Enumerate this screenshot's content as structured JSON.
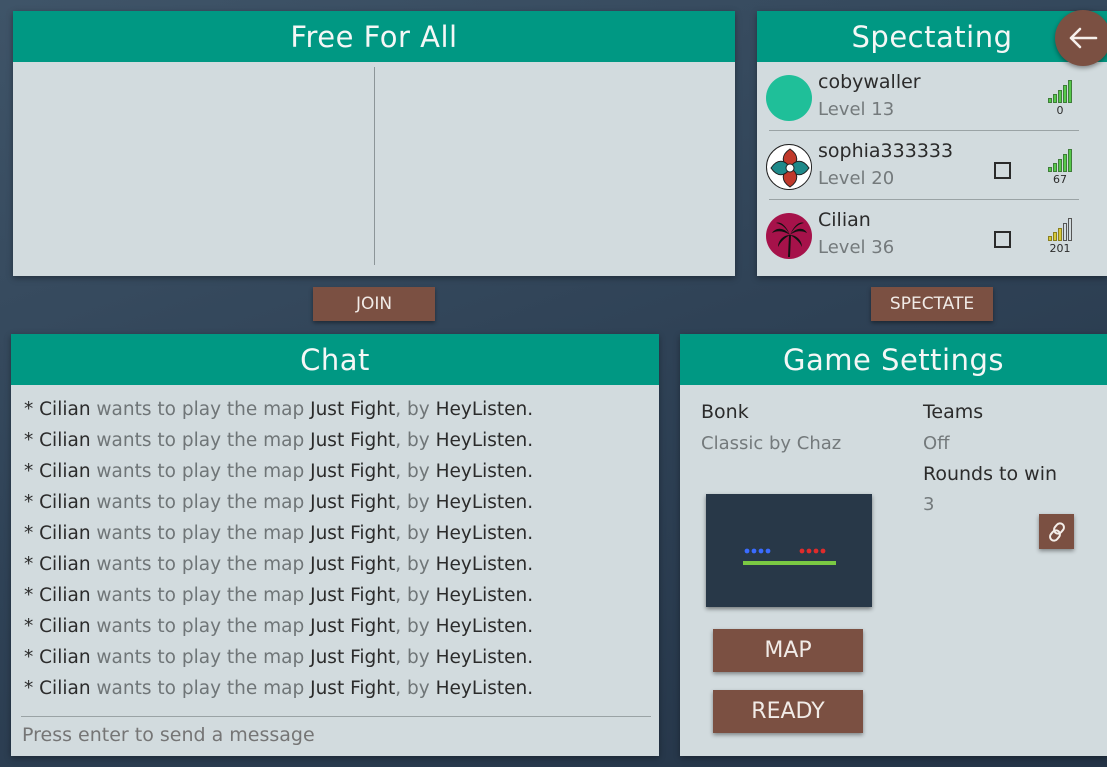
{
  "lobby": {
    "title": "Free For All",
    "join_label": "JOIN"
  },
  "spectating": {
    "title": "Spectating",
    "spectate_label": "SPECTATE",
    "players": [
      {
        "name": "cobywaller",
        "level": "Level 13",
        "ping": "0",
        "avatar_color": "#1fbf99",
        "show_checkbox": false,
        "signal_bars": 5,
        "signal_color": "#56c94a"
      },
      {
        "name": "sophia333333",
        "level": "Level 20",
        "ping": "67",
        "avatar_color": "#ffffff",
        "show_checkbox": true,
        "signal_bars": 5,
        "signal_color": "#56c94a"
      },
      {
        "name": "Cilian",
        "level": "Level 36",
        "ping": "201",
        "avatar_color": "#a6124a",
        "show_checkbox": true,
        "signal_bars": 3,
        "signal_color": "#d6c83a"
      }
    ]
  },
  "back_icon": "arrow-left-icon",
  "chat": {
    "title": "Chat",
    "messages": [
      {
        "prefix": "* ",
        "user": "Cilian",
        "text1": " wants to play the map ",
        "map": "Just Fight",
        "text2": ", by ",
        "author": "HeyListen",
        "end": "."
      },
      {
        "prefix": "* ",
        "user": "Cilian",
        "text1": " wants to play the map ",
        "map": "Just Fight",
        "text2": ", by ",
        "author": "HeyListen",
        "end": "."
      },
      {
        "prefix": "* ",
        "user": "Cilian",
        "text1": " wants to play the map ",
        "map": "Just Fight",
        "text2": ", by ",
        "author": "HeyListen",
        "end": "."
      },
      {
        "prefix": "* ",
        "user": "Cilian",
        "text1": " wants to play the map ",
        "map": "Just Fight",
        "text2": ", by ",
        "author": "HeyListen",
        "end": "."
      },
      {
        "prefix": "* ",
        "user": "Cilian",
        "text1": " wants to play the map ",
        "map": "Just Fight",
        "text2": ", by ",
        "author": "HeyListen",
        "end": "."
      },
      {
        "prefix": "* ",
        "user": "Cilian",
        "text1": " wants to play the map ",
        "map": "Just Fight",
        "text2": ", by ",
        "author": "HeyListen",
        "end": "."
      },
      {
        "prefix": "* ",
        "user": "Cilian",
        "text1": " wants to play the map ",
        "map": "Just Fight",
        "text2": ", by ",
        "author": "HeyListen",
        "end": "."
      },
      {
        "prefix": "* ",
        "user": "Cilian",
        "text1": " wants to play the map ",
        "map": "Just Fight",
        "text2": ", by ",
        "author": "HeyListen",
        "end": "."
      },
      {
        "prefix": "* ",
        "user": "Cilian",
        "text1": " wants to play the map ",
        "map": "Just Fight",
        "text2": ", by ",
        "author": "HeyListen",
        "end": "."
      },
      {
        "prefix": "* ",
        "user": "Cilian",
        "text1": " wants to play the map ",
        "map": "Just Fight",
        "text2": ", by ",
        "author": "HeyListen",
        "end": "."
      }
    ],
    "input_placeholder": "Press enter to send a message"
  },
  "settings": {
    "title": "Game Settings",
    "mode_label": "Bonk",
    "mode_value": "Classic by Chaz",
    "teams_label": "Teams",
    "teams_value": "Off",
    "rounds_label": "Rounds to win",
    "rounds_value": "3",
    "map_button": "MAP",
    "ready_button": "READY",
    "link_icon": "link-icon",
    "colors": {
      "accent": "#009883",
      "button": "#7b5042",
      "panel": "#d2dbde"
    }
  }
}
